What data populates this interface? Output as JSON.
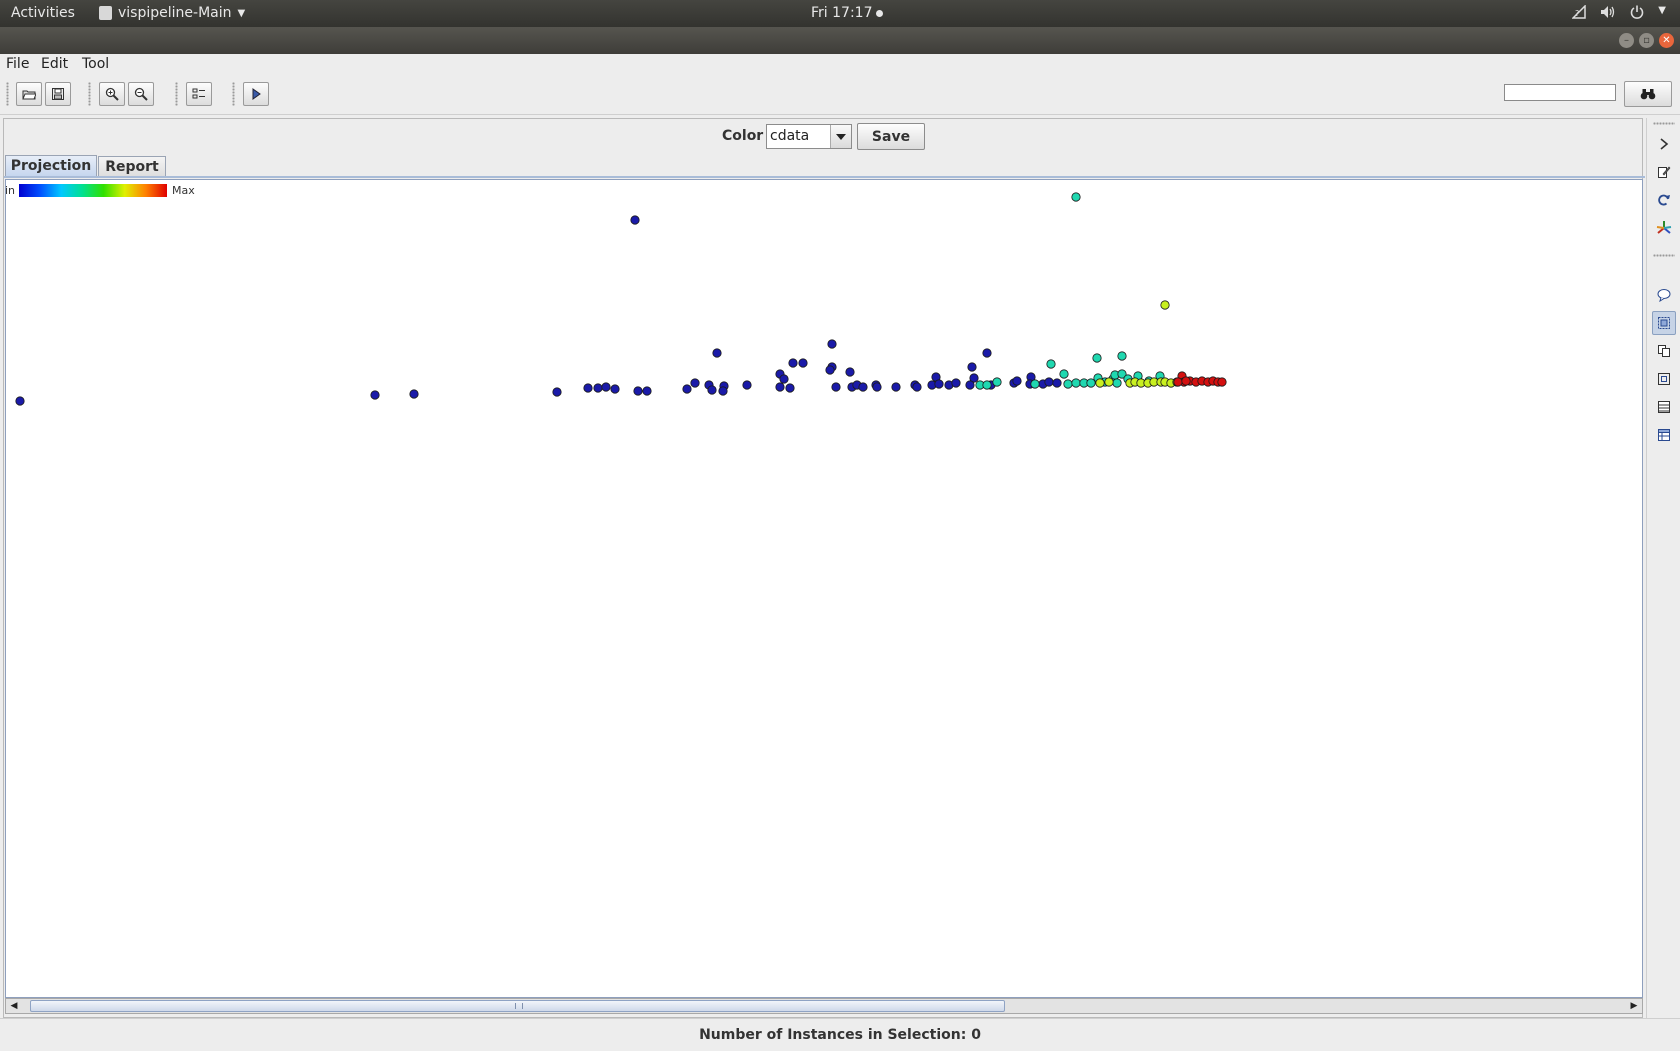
{
  "topbar": {
    "activities": "Activities",
    "app_name": "vispipeline-Main",
    "clock": "Fri 17:17"
  },
  "menubar": {
    "file": "File",
    "edit": "Edit",
    "tool": "Tool"
  },
  "toolbar": {
    "buttons": [
      "open-icon",
      "save-icon",
      "zoom-in-icon",
      "zoom-out-icon",
      "checklist-icon",
      "play-icon"
    ],
    "search_value": "",
    "find_icon": "binoculars-icon"
  },
  "controls": {
    "color_label": "Color",
    "color_value": "cdata",
    "save_label": "Save"
  },
  "tabs": [
    {
      "label": "Projection",
      "selected": true
    },
    {
      "label": "Report",
      "selected": false
    }
  ],
  "legend": {
    "min_label": "in",
    "max_label": "Max"
  },
  "status": {
    "selection_text": "Number of Instances in Selection: 0"
  },
  "side_toolbar": {
    "buttons": [
      "arrow-right-icon",
      "edit-icon",
      "refresh-icon",
      "star-tool-icon",
      "speech-bubble-icon",
      "selection-box-icon",
      "copy-icon",
      "frame-icon",
      "list-icon",
      "table-icon"
    ],
    "active": "selection-box-icon"
  },
  "colors": {
    "scale": [
      "#0000d0",
      "#0050ff",
      "#00c8ff",
      "#00e090",
      "#30e000",
      "#e0f000",
      "#ff8000",
      "#e00000"
    ],
    "point_stroke": "#1a1a1a"
  }
}
